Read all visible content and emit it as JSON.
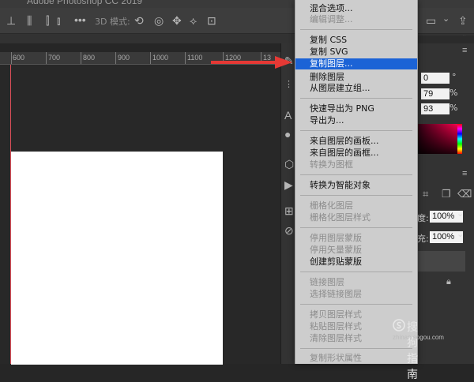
{
  "window": {
    "title": "Adobe Photoshop CC 2019"
  },
  "options_bar": {
    "label_3d": "3D 模式:"
  },
  "ruler": {
    "ticks": [
      "600",
      "700",
      "800",
      "900",
      "1000",
      "1100",
      "1200",
      "13"
    ]
  },
  "panels": {
    "angle_value": "0",
    "angle_unit": "°",
    "field2_value": "79",
    "field2_unit": "%",
    "field3_value": "93",
    "field3_unit": "%",
    "opacity_label": "度:",
    "opacity_value": "100%",
    "fill_label": "充:",
    "fill_value": "100%"
  },
  "context_menu": {
    "items": [
      {
        "label": "混合选项...",
        "state": "enabled"
      },
      {
        "label": "编辑调整...",
        "state": "disabled"
      },
      {
        "label": "复制 CSS",
        "state": "enabled"
      },
      {
        "label": "复制 SVG",
        "state": "enabled"
      },
      {
        "label": "复制图层...",
        "state": "highlighted"
      },
      {
        "label": "删除图层",
        "state": "enabled"
      },
      {
        "label": "从图层建立组...",
        "state": "enabled"
      },
      {
        "label": "快速导出为 PNG",
        "state": "enabled"
      },
      {
        "label": "导出为...",
        "state": "enabled"
      },
      {
        "label": "来自图层的画板...",
        "state": "enabled"
      },
      {
        "label": "来自图层的画框...",
        "state": "enabled"
      },
      {
        "label": "转换为图框",
        "state": "disabled"
      },
      {
        "label": "转换为智能对象",
        "state": "enabled"
      },
      {
        "label": "栅格化图层",
        "state": "disabled"
      },
      {
        "label": "栅格化图层样式",
        "state": "disabled"
      },
      {
        "label": "停用图层蒙版",
        "state": "disabled"
      },
      {
        "label": "停用矢量蒙版",
        "state": "disabled"
      },
      {
        "label": "创建剪贴蒙版",
        "state": "enabled"
      },
      {
        "label": "链接图层",
        "state": "disabled"
      },
      {
        "label": "选择链接图层",
        "state": "disabled"
      },
      {
        "label": "拷贝图层样式",
        "state": "disabled"
      },
      {
        "label": "粘贴图层样式",
        "state": "disabled"
      },
      {
        "label": "清除图层样式",
        "state": "disabled"
      },
      {
        "label": "复制形状属性",
        "state": "disabled"
      }
    ]
  },
  "annotation": {
    "arrow_color": "#e53935",
    "highlight_color": "#1b63d6"
  },
  "watermark": {
    "text": "搜狗指南",
    "sub": "zhinan.sogou.com"
  }
}
